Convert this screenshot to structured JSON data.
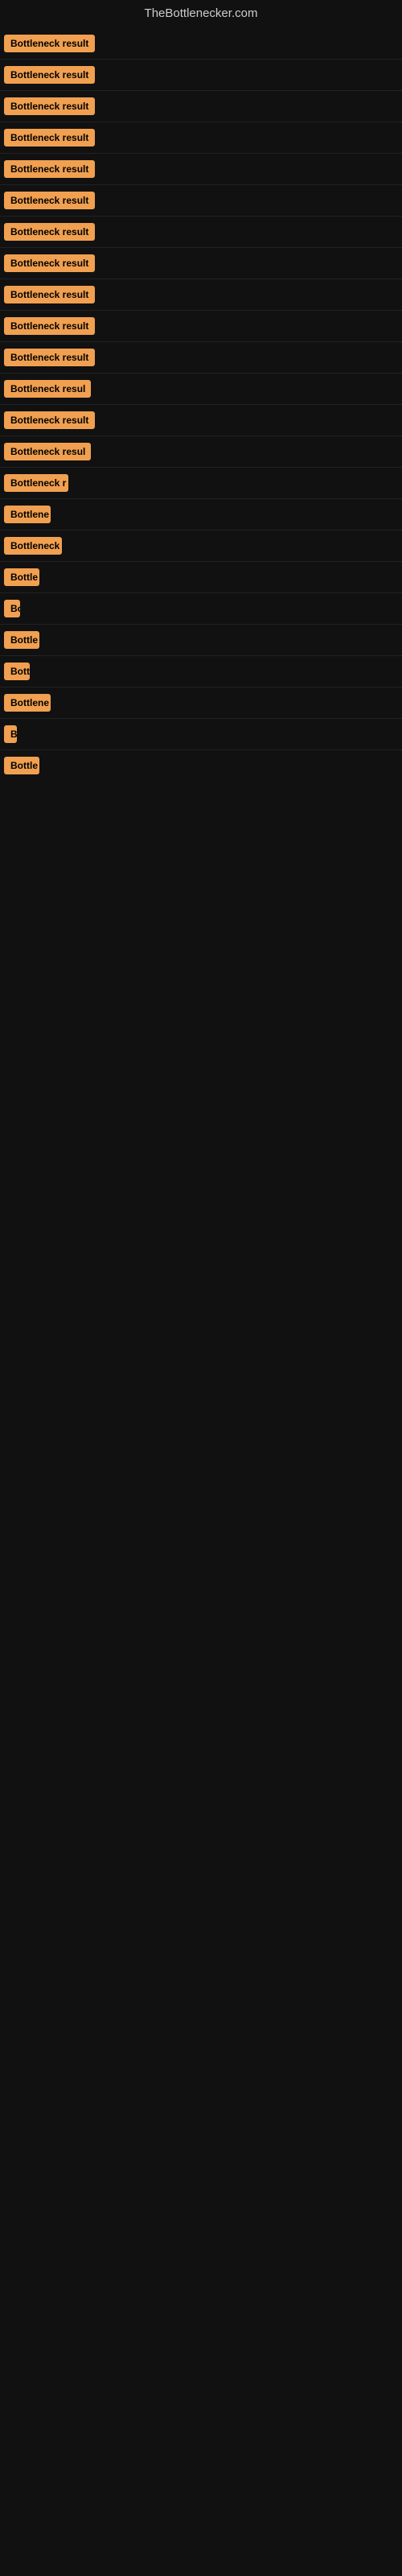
{
  "site": {
    "title": "TheBottlenecker.com"
  },
  "badges": [
    {
      "id": 1,
      "label": "Bottleneck result",
      "visible_chars": 16
    },
    {
      "id": 2,
      "label": "Bottleneck result",
      "visible_chars": 16
    },
    {
      "id": 3,
      "label": "Bottleneck result",
      "visible_chars": 16
    },
    {
      "id": 4,
      "label": "Bottleneck result",
      "visible_chars": 16
    },
    {
      "id": 5,
      "label": "Bottleneck result",
      "visible_chars": 16
    },
    {
      "id": 6,
      "label": "Bottleneck result",
      "visible_chars": 16
    },
    {
      "id": 7,
      "label": "Bottleneck result",
      "visible_chars": 16
    },
    {
      "id": 8,
      "label": "Bottleneck result",
      "visible_chars": 16
    },
    {
      "id": 9,
      "label": "Bottleneck result",
      "visible_chars": 16
    },
    {
      "id": 10,
      "label": "Bottleneck result",
      "visible_chars": 16
    },
    {
      "id": 11,
      "label": "Bottleneck result",
      "visible_chars": 16
    },
    {
      "id": 12,
      "label": "Bottleneck resul",
      "visible_chars": 15
    },
    {
      "id": 13,
      "label": "Bottleneck result",
      "visible_chars": 16
    },
    {
      "id": 14,
      "label": "Bottleneck resul",
      "visible_chars": 15
    },
    {
      "id": 15,
      "label": "Bottleneck r",
      "visible_chars": 11
    },
    {
      "id": 16,
      "label": "Bottlene",
      "visible_chars": 8
    },
    {
      "id": 17,
      "label": "Bottleneck",
      "visible_chars": 10
    },
    {
      "id": 18,
      "label": "Bottle",
      "visible_chars": 6
    },
    {
      "id": 19,
      "label": "Bo",
      "visible_chars": 2
    },
    {
      "id": 20,
      "label": "Bottle",
      "visible_chars": 6
    },
    {
      "id": 21,
      "label": "Bott",
      "visible_chars": 4
    },
    {
      "id": 22,
      "label": "Bottlene",
      "visible_chars": 8
    },
    {
      "id": 23,
      "label": "B",
      "visible_chars": 1
    },
    {
      "id": 24,
      "label": "Bottle",
      "visible_chars": 6
    }
  ],
  "colors": {
    "badge_bg": "#f0a050",
    "badge_text": "#000000",
    "background": "#111111",
    "site_title": "#cccccc"
  }
}
